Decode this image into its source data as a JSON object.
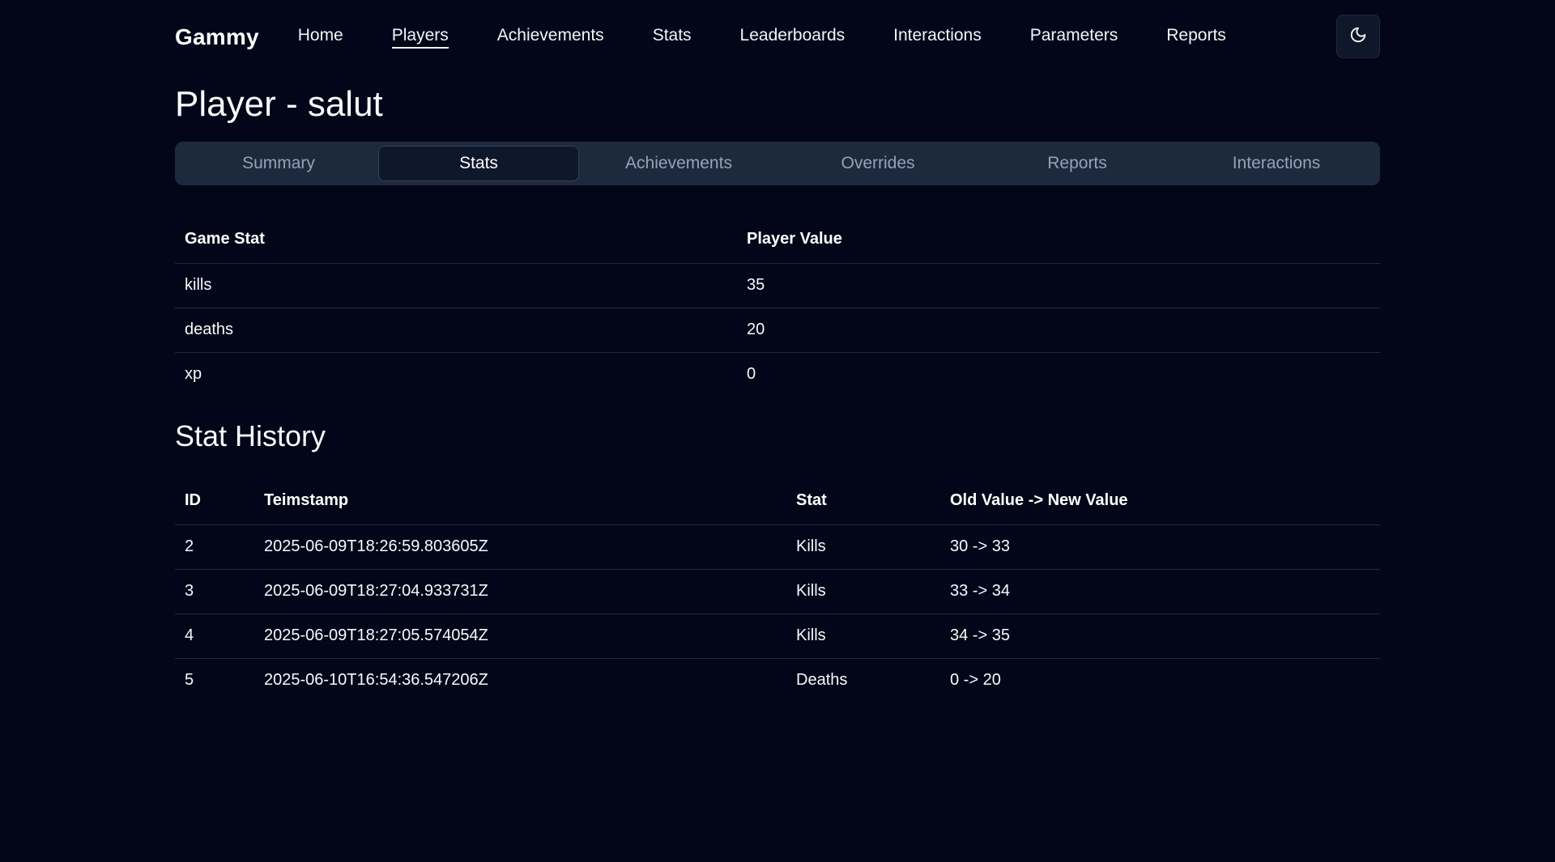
{
  "nav": {
    "brand": "Gammy",
    "links": [
      {
        "label": "Home",
        "active": false
      },
      {
        "label": "Players",
        "active": true
      },
      {
        "label": "Achievements",
        "active": false
      },
      {
        "label": "Stats",
        "active": false
      },
      {
        "label": "Leaderboards",
        "active": false
      },
      {
        "label": "Interactions",
        "active": false
      },
      {
        "label": "Parameters",
        "active": false
      },
      {
        "label": "Reports",
        "active": false
      }
    ],
    "theme_icon": "moon-icon"
  },
  "page": {
    "title": "Player - salut"
  },
  "tabs": [
    {
      "label": "Summary",
      "active": false
    },
    {
      "label": "Stats",
      "active": true
    },
    {
      "label": "Achievements",
      "active": false
    },
    {
      "label": "Overrides",
      "active": false
    },
    {
      "label": "Reports",
      "active": false
    },
    {
      "label": "Interactions",
      "active": false
    }
  ],
  "stats_table": {
    "headers": [
      "Game Stat",
      "Player Value"
    ],
    "rows": [
      [
        "kills",
        "35"
      ],
      [
        "deaths",
        "20"
      ],
      [
        "xp",
        "0"
      ]
    ]
  },
  "history": {
    "title": "Stat History",
    "headers": [
      "ID",
      "Teimstamp",
      "Stat",
      "Old Value -> New Value"
    ],
    "rows": [
      [
        "2",
        "2025-06-09T18:26:59.803605Z",
        "Kills",
        "30 -> 33"
      ],
      [
        "3",
        "2025-06-09T18:27:04.933731Z",
        "Kills",
        "33 -> 34"
      ],
      [
        "4",
        "2025-06-09T18:27:05.574054Z",
        "Kills",
        "34 -> 35"
      ],
      [
        "5",
        "2025-06-10T16:54:36.547206Z",
        "Deaths",
        "0 -> 20"
      ]
    ]
  },
  "colors": {
    "background": "#020618",
    "tab_bar": "#1d293d",
    "tab_active": "#0f172b",
    "text": "#f8fafc",
    "muted": "#94a3b8"
  }
}
